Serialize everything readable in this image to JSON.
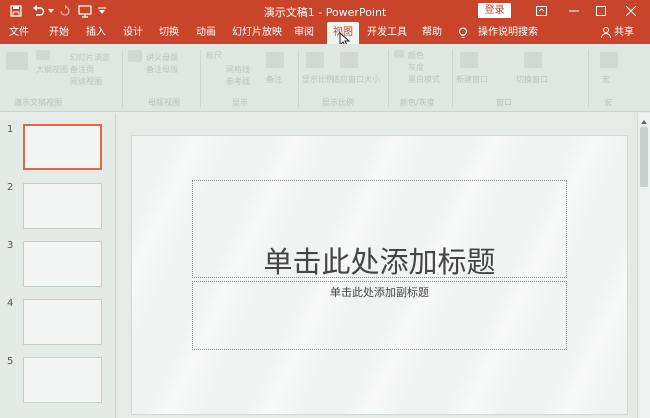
{
  "titlebar": {
    "title": "演示文稿1 - PowerPoint",
    "login_label": "登录",
    "accent": "#c8442a"
  },
  "quick_access": [
    "save-icon",
    "undo-icon",
    "redo-icon",
    "slideshow-from-start-icon",
    "customize-icon"
  ],
  "window_controls": [
    "ribbon-display-options-icon",
    "minimize-icon",
    "maximize-icon",
    "close-icon"
  ],
  "tabs": [
    {
      "label": "文件"
    },
    {
      "label": "开始"
    },
    {
      "label": "插入"
    },
    {
      "label": "设计"
    },
    {
      "label": "切换"
    },
    {
      "label": "动画"
    },
    {
      "label": "幻灯片放映"
    },
    {
      "label": "审阅"
    },
    {
      "label": "视图",
      "active": true
    },
    {
      "label": "开发工具"
    },
    {
      "label": "帮助"
    }
  ],
  "tell_me": {
    "label": "操作说明搜索",
    "icon": "lightbulb-icon"
  },
  "share": {
    "label": "共享",
    "icon": "person-icon"
  },
  "ribbon": {
    "groups": [
      {
        "label": "演示文稿视图"
      },
      {
        "label": "母版视图"
      },
      {
        "label": "显示"
      },
      {
        "label": "显示比例"
      },
      {
        "label": "颜色/灰度"
      },
      {
        "label": "窗口"
      },
      {
        "label": "宏"
      }
    ],
    "items": {
      "outline": "大纲视图",
      "slide_sorter": "幻灯片浏览",
      "notes_page": "备注页",
      "reading_view": "阅读视图",
      "handout_master": "讲义母版",
      "notes_master": "备注母版",
      "ruler": "标尺",
      "gridlines": "网格线",
      "guides": "参考线",
      "notes": "备注",
      "zoom": "显示比例",
      "fit_window": "适应窗口大小",
      "color": "颜色",
      "grayscale": "灰度",
      "black_white": "黑白模式",
      "new_window": "新建窗口",
      "switch_windows": "切换窗口",
      "macros": "宏"
    }
  },
  "thumbnails": [
    {
      "num": "1",
      "selected": true
    },
    {
      "num": "2"
    },
    {
      "num": "3"
    },
    {
      "num": "4"
    },
    {
      "num": "5"
    }
  ],
  "slide": {
    "title_placeholder": "单击此处添加标题",
    "subtitle_placeholder": "单击此处添加副标题"
  }
}
